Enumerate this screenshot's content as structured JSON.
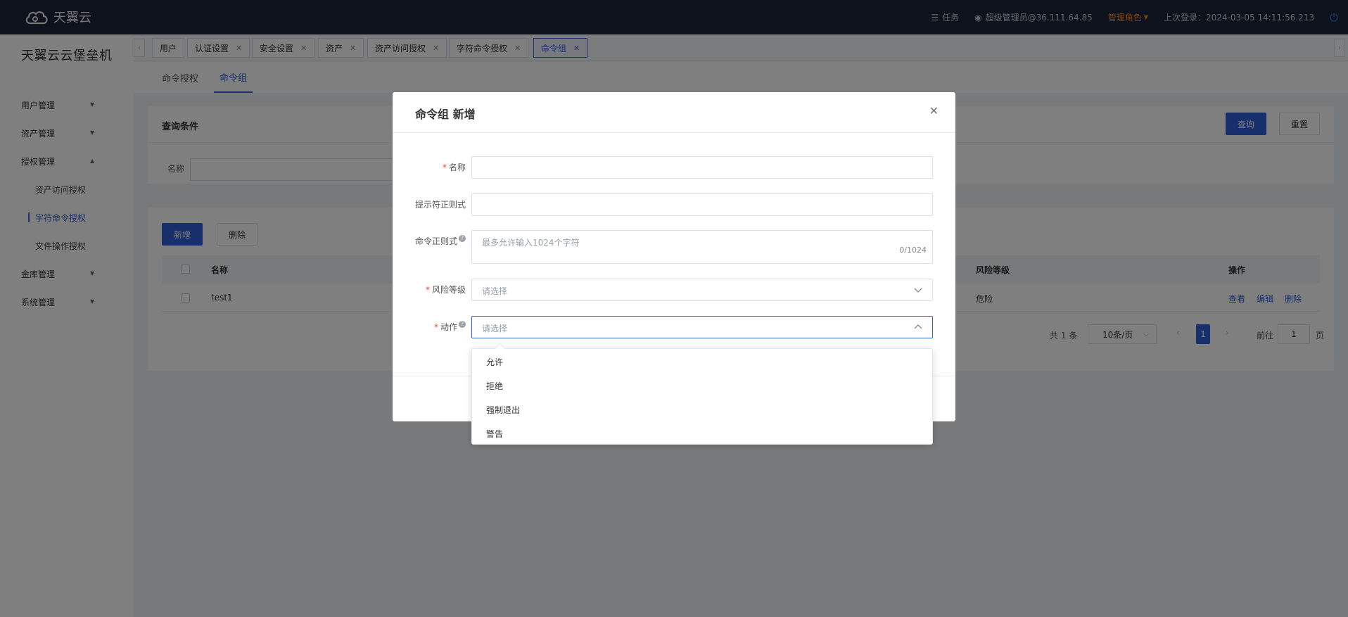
{
  "header": {
    "brand": "天翼云",
    "task_label": "任务",
    "user": "超级管理员@36.111.64.85",
    "role": "管理角色",
    "last_login": "上次登录：2024-03-05 14:11:56.213"
  },
  "sidebar": {
    "title": "天翼云云堡垒机",
    "items": [
      {
        "label": "用户管理"
      },
      {
        "label": "资产管理"
      },
      {
        "label": "授权管理"
      },
      {
        "label": "资产访问授权"
      },
      {
        "label": "字符命令授权"
      },
      {
        "label": "文件操作授权"
      },
      {
        "label": "金库管理"
      },
      {
        "label": "系统管理"
      }
    ]
  },
  "tabs": [
    {
      "label": "用户"
    },
    {
      "label": "认证设置"
    },
    {
      "label": "安全设置"
    },
    {
      "label": "资产"
    },
    {
      "label": "资产访问授权"
    },
    {
      "label": "字符命令授权"
    },
    {
      "label": "命令组"
    }
  ],
  "subtabs": [
    {
      "label": "命令授权"
    },
    {
      "label": "命令组"
    }
  ],
  "query": {
    "title": "查询条件",
    "name_label": "名称",
    "search_btn": "查询",
    "reset_btn": "重置"
  },
  "list": {
    "add_btn": "新增",
    "delete_btn": "删除",
    "columns": [
      "名称",
      "风险等级",
      "操作"
    ],
    "rows": [
      {
        "name": "test1",
        "risk": "危险",
        "view": "查看",
        "edit": "编辑",
        "delete": "删除"
      }
    ]
  },
  "pagination": {
    "total": "共 1 条",
    "page_size": "10条/页",
    "current": "1",
    "goto_label": "前往",
    "goto_value": "1",
    "page_suffix": "页"
  },
  "dialog": {
    "title": "命令组 新增",
    "name_label": "名称",
    "prompt_label": "提示符正则式",
    "command_label": "命令正则式",
    "command_placeholder": "最多允许输入1024个字符",
    "command_counter": "0/1024",
    "risk_label": "风险等级",
    "risk_placeholder": "请选择",
    "action_label": "动作",
    "action_placeholder": "请选择",
    "action_options": [
      "允许",
      "拒绝",
      "强制退出",
      "警告"
    ]
  }
}
